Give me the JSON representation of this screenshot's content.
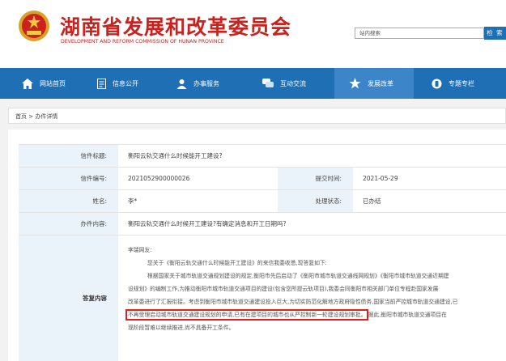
{
  "header": {
    "title_cn": "湖南省发展和改革委员会",
    "title_en": "DEVELOPMENT AND REFORM COMMISSION OF HUNAN PROVINCE",
    "search_placeholder": "站内搜索",
    "search_button": "检 索",
    "brand_color": "#c9221f"
  },
  "nav": {
    "color": "#1f6fb4",
    "items": [
      {
        "label": "网站首页",
        "icon": "home-icon"
      },
      {
        "label": "信息公开",
        "icon": "document-icon"
      },
      {
        "label": "办事服务",
        "icon": "person-icon"
      },
      {
        "label": "互动交流",
        "icon": "chat-icon"
      },
      {
        "label": "发展改革",
        "icon": "star-icon"
      },
      {
        "label": "专题专栏",
        "icon": "phone-icon"
      }
    ]
  },
  "breadcrumb": {
    "home": "首页",
    "current": "办件详情"
  },
  "detail": {
    "title_label": "信件标题:",
    "title_value": "衡阳云轨交通什么时候能开工建设?",
    "number_label": "信件编号:",
    "number_value": "2021052900000026",
    "submit_label": "提交时间:",
    "submit_value": "2021-05-29",
    "name_label": "姓名:",
    "name_value": "李*",
    "status_label": "处理状态:",
    "status_value": "已办结",
    "content_label": "办件内容:",
    "content_value": "衡阳云轨交通什么时候开工建设?有确定消息和开工日期吗?",
    "reply_label": "答复内容",
    "reply_greeting": "李瑞网友:",
    "reply_p1": "您关于《衡阳云轨交通什么时候能开工建设》的来信我委收悉,现答复如下:",
    "reply_p2a": "根据国家关于城市轨道交通规划建设的规定,衡阳市先后启动了《衡阳市城市轨道交通线网规划》《衡阳市城市轨道交通近期建",
    "reply_p2b": "设规划》的编制工作,为推动衡阳市城市轨道交通项目的建设(包含您所提云轨项目),我委会同衡阳市相关部门单位专程赴国家发展",
    "reply_p2c": "改革委进行了汇报衔接。考虑到衡阳市城市轨道交通建设投入巨大,为切实防范化解地方政府隐性债务,国家当前严控城市轨道交通建设,已",
    "reply_highlight": "不再受理启动城市轨道交通建设规划的申请,已有在建项目的城市也从严控制新一轮建设规划审批。",
    "reply_p2d": "据此,衡阳市城市轨道交通项目在",
    "reply_p2e": "现阶段暂难以继续推进,尚不具备开工条件。"
  }
}
